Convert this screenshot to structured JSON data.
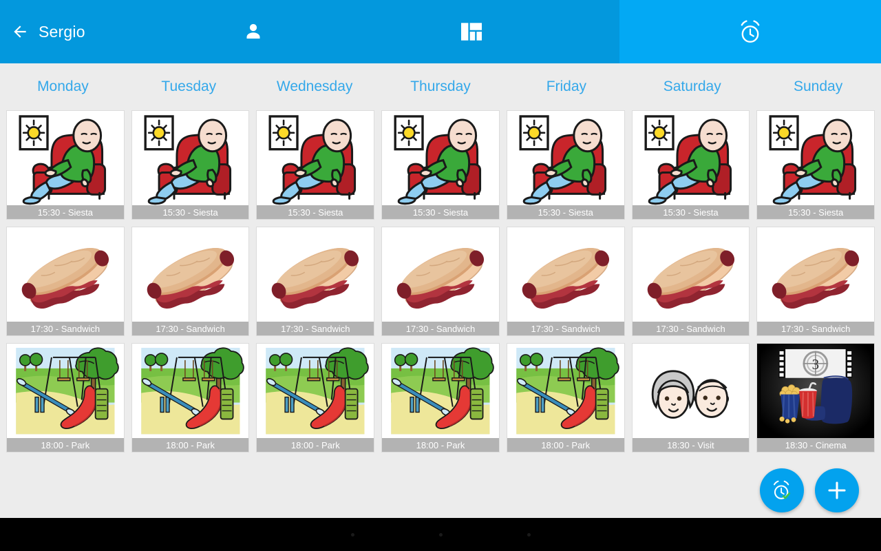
{
  "appbar": {
    "back_icon": "back-arrow-icon",
    "title": "Sergio",
    "tabs": [
      {
        "id": "profile",
        "icon": "person-icon",
        "selected": false
      },
      {
        "id": "dashboard",
        "icon": "dashboard-icon",
        "selected": false
      },
      {
        "id": "agenda",
        "icon": "alarm-clock-icon",
        "selected": true
      }
    ],
    "bg_color": "#0398dd",
    "selected_tab_color": "#03a9f4"
  },
  "week": {
    "days": [
      "Monday",
      "Tuesday",
      "Wednesday",
      "Thursday",
      "Friday",
      "Saturday",
      "Sunday"
    ],
    "day_color": "#34a8ea"
  },
  "rows": [
    {
      "cells": [
        {
          "pict": "siesta",
          "label": "15:30 - Siesta"
        },
        {
          "pict": "siesta",
          "label": "15:30 - Siesta"
        },
        {
          "pict": "siesta",
          "label": "15:30 - Siesta"
        },
        {
          "pict": "siesta",
          "label": "15:30 - Siesta"
        },
        {
          "pict": "siesta",
          "label": "15:30 - Siesta"
        },
        {
          "pict": "siesta",
          "label": "15:30 - Siesta"
        },
        {
          "pict": "siesta",
          "label": "15:30 - Siesta"
        }
      ]
    },
    {
      "cells": [
        {
          "pict": "sandwich",
          "label": "17:30 - Sandwich"
        },
        {
          "pict": "sandwich",
          "label": "17:30 - Sandwich"
        },
        {
          "pict": "sandwich",
          "label": "17:30 - Sandwich"
        },
        {
          "pict": "sandwich",
          "label": "17:30 - Sandwich"
        },
        {
          "pict": "sandwich",
          "label": "17:30 - Sandwich"
        },
        {
          "pict": "sandwich",
          "label": "17:30 - Sandwich"
        },
        {
          "pict": "sandwich",
          "label": "17:30 - Sandwich"
        }
      ]
    },
    {
      "cells": [
        {
          "pict": "park",
          "label": "18:00 - Park"
        },
        {
          "pict": "park",
          "label": "18:00 - Park"
        },
        {
          "pict": "park",
          "label": "18:00 - Park"
        },
        {
          "pict": "park",
          "label": "18:00 - Park"
        },
        {
          "pict": "park",
          "label": "18:00 - Park"
        },
        {
          "pict": "visit",
          "label": "18:30 - Visit"
        },
        {
          "pict": "cinema",
          "label": "18:30 - Cinema"
        }
      ]
    }
  ],
  "fabs": [
    {
      "id": "alarm-check",
      "icon": "alarm-check-icon",
      "label": ""
    },
    {
      "id": "add",
      "icon": "plus-icon",
      "label": ""
    }
  ],
  "navbar": {
    "dots": 3,
    "bg_color": "#000000"
  },
  "label_bar_color": "#b3b3b3",
  "page_bg": "#ececec"
}
